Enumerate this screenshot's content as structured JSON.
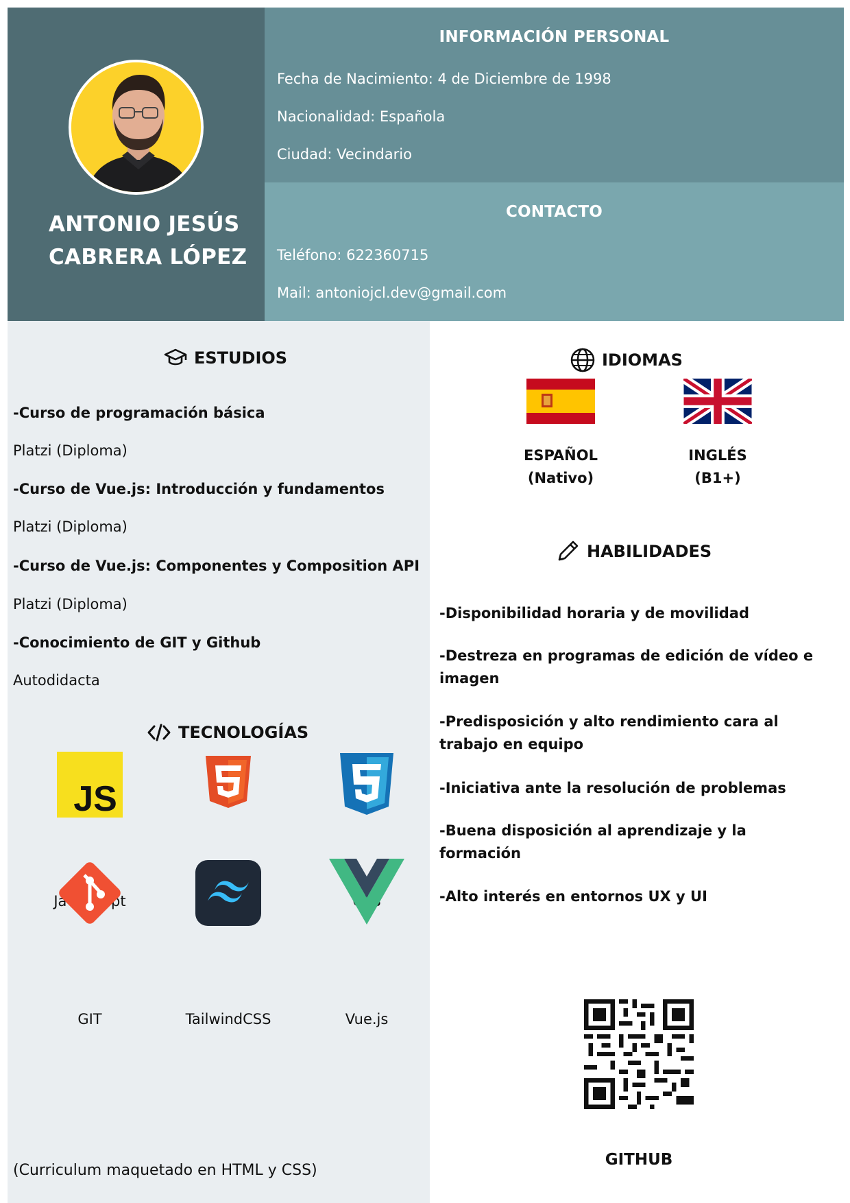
{
  "profile": {
    "name_line1": "ANTONIO JESÚS",
    "name_line2": "CABRERA LÓPEZ",
    "photo_bg_color": "#fcd12a"
  },
  "personal": {
    "title": "INFORMACIÓN PERSONAL",
    "birth": "Fecha de Nacimiento: 4 de Diciembre de 1998",
    "nationality": "Nacionalidad: Española",
    "city": "Ciudad: Vecindario"
  },
  "contact": {
    "title": "CONTACTO",
    "phone": "Teléfono: 622360715",
    "mail": "Mail: antoniojcl.dev@gmail.com"
  },
  "studies": {
    "title": "ESTUDIOS",
    "icon": "graduation-cap-icon",
    "items": [
      {
        "course": "-Curso de programación básica",
        "detail": "Platzi (Diploma)"
      },
      {
        "course": "-Curso de Vue.js: Introducción y fundamentos",
        "detail": "Platzi (Diploma)"
      },
      {
        "course": "-Curso de Vue.js: Componentes y Composition API",
        "detail": "Platzi (Diploma)"
      },
      {
        "course": "-Conocimiento de GIT y Github",
        "detail": "Autodidacta"
      }
    ]
  },
  "technologies": {
    "title": "TECNOLOGÍAS",
    "icon": "code-icon",
    "items": [
      {
        "label": "JavaScript",
        "icon": "javascript-logo-icon"
      },
      {
        "label": "HTML",
        "icon": "html5-logo-icon"
      },
      {
        "label": "CSS",
        "icon": "css3-logo-icon"
      },
      {
        "label": "GIT",
        "icon": "git-logo-icon"
      },
      {
        "label": "TailwindCSS",
        "icon": "tailwind-logo-icon"
      },
      {
        "label": "Vue.js",
        "icon": "vue-logo-icon"
      }
    ]
  },
  "languages": {
    "title": "IDIOMAS",
    "icon": "globe-icon",
    "items": [
      {
        "name": "ESPAÑOL",
        "level": "(Nativo)",
        "icon": "spain-flag-icon"
      },
      {
        "name": "INGLÉS",
        "level": "(B1+)",
        "icon": "uk-flag-icon"
      }
    ]
  },
  "skills": {
    "title": "HABILIDADES",
    "icon": "pencil-icon",
    "items": [
      "-Disponibilidad horaria y de movilidad",
      "-Destreza en programas de edición de vídeo e imagen",
      "-Predisposición y alto rendimiento cara al trabajo en equipo",
      "-Iniciativa ante la resolución de problemas",
      "-Buena disposición al aprendizaje y la formación",
      "-Alto interés en entornos UX y UI"
    ]
  },
  "github": {
    "label": "GITHUB",
    "icon": "qr-code-icon"
  },
  "footnote": "(Curriculum maquetado en HTML y CSS)",
  "colors": {
    "profile_bg": "#4f6c73",
    "personal_bg": "#678f97",
    "contact_bg": "#7aa7ae",
    "left_bg": "#eaeef1"
  }
}
